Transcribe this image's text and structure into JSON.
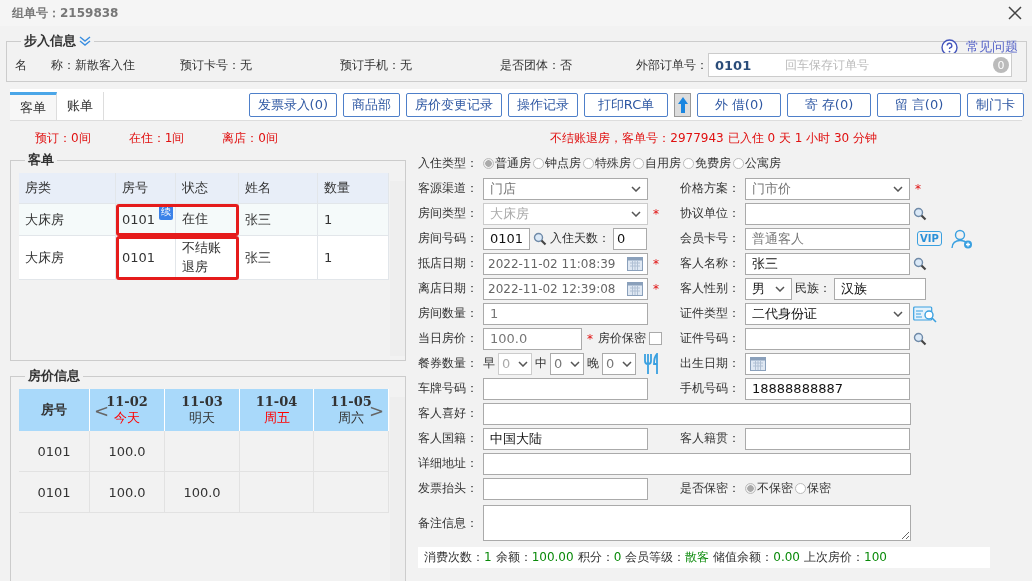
{
  "dialog": {
    "title": "组单号：2159838"
  },
  "checkin_info": {
    "legend": "步入信息",
    "help_link": "常见问题",
    "fields": [
      {
        "label": "名　　称：",
        "value": "新散客入住"
      },
      {
        "label": "预订卡号：",
        "value": "无"
      },
      {
        "label": "预订手机：",
        "value": "无"
      },
      {
        "label": "是否团体：",
        "value": "否"
      }
    ],
    "external_order": {
      "label": "外部订单号：",
      "value": "0101",
      "placeholder": "回车保存订单号",
      "count": "0"
    }
  },
  "tabs": [
    {
      "label": "客单",
      "selected": true
    },
    {
      "label": "账单",
      "selected": false
    }
  ],
  "toolbar": [
    {
      "kind": "text",
      "label": "发票录入(0)"
    },
    {
      "kind": "text",
      "label": "商品部"
    },
    {
      "kind": "text",
      "label": "房价变更记录"
    },
    {
      "kind": "text",
      "label": "操作记录"
    },
    {
      "kind": "text",
      "label": "打印RC单"
    },
    {
      "kind": "arrow"
    },
    {
      "kind": "text",
      "label": "外 借(0)"
    },
    {
      "kind": "text",
      "label": "寄 存(0)"
    },
    {
      "kind": "text",
      "label": "留 言(0)"
    },
    {
      "kind": "text",
      "label": "制门卡"
    }
  ],
  "stats": [
    "预订：0间",
    "在住：1间",
    "离店：0间"
  ],
  "status_message": "不结账退房，客单号：2977943 已入住 0 天 1 小时 30 分钟",
  "guest_table": {
    "legend": "客单",
    "columns": [
      "房类",
      "房号",
      "状态",
      "姓名",
      "数量"
    ],
    "rows": [
      {
        "cells": [
          "大床房",
          "0101",
          "在住",
          "张三",
          "1"
        ],
        "badge": "续",
        "highlighted": true
      },
      {
        "cells": [
          "大床房",
          "0101",
          "不结账退房",
          "张三",
          "1"
        ],
        "highlighted": true
      }
    ]
  },
  "price_table": {
    "legend": "房价信息",
    "room_header": "房号",
    "prev": "<",
    "next": ">",
    "days": [
      {
        "date": "11-02",
        "label": "今天",
        "emphasized": true
      },
      {
        "date": "11-03",
        "label": "明天",
        "emphasized": false
      },
      {
        "date": "11-04",
        "label": "周五",
        "emphasized": true
      },
      {
        "date": "11-05",
        "label": "周六",
        "emphasized": false
      }
    ],
    "rows": [
      {
        "room": "0101",
        "prices": [
          "100.0"
        ]
      },
      {
        "room": "0101",
        "prices": [
          "100.0",
          "100.0"
        ]
      }
    ]
  },
  "form": [
    {
      "wide": {
        "label": "入住类型：",
        "controls": [
          {
            "kind": "radios",
            "options": [
              {
                "label": "普通房",
                "selected": true
              },
              {
                "label": "钟点房",
                "selected": false
              },
              {
                "label": "特殊房",
                "selected": false
              },
              {
                "label": "自用房",
                "selected": false
              },
              {
                "label": "免费房",
                "selected": false
              },
              {
                "label": "公寓房",
                "selected": false
              }
            ]
          }
        ]
      }
    },
    {
      "left": {
        "label": "客源渠道：",
        "controls": [
          {
            "kind": "select",
            "value": "门店"
          }
        ]
      },
      "right": {
        "label": "价格方案：",
        "controls": [
          {
            "kind": "select",
            "value": "门市价"
          },
          {
            "kind": "required",
            "text": "*"
          }
        ]
      }
    },
    {
      "left": {
        "label": "房间类型：",
        "controls": [
          {
            "kind": "select",
            "value": "大床房",
            "disabled": true
          },
          {
            "kind": "required",
            "text": "*"
          }
        ]
      },
      "right": {
        "label": "协议单位：",
        "controls": [
          {
            "kind": "text"
          },
          {
            "kind": "lookup"
          }
        ]
      }
    },
    {
      "left": {
        "label": "房间号码：",
        "controls": [
          {
            "kind": "short-text",
            "value": "0101"
          },
          {
            "kind": "lookup"
          },
          {
            "kind": "caption",
            "text": "入住天数："
          },
          {
            "kind": "tiny-text",
            "value": "0"
          }
        ]
      },
      "right": {
        "label": "会员卡号：",
        "controls": [
          {
            "kind": "text",
            "value": "普通客人",
            "muted": true
          },
          {
            "kind": "vip",
            "text": "VIP"
          },
          {
            "kind": "add-member"
          }
        ]
      }
    },
    {
      "left": {
        "label": "抵店日期：",
        "controls": [
          {
            "kind": "date",
            "value": "2022-11-02 11:08:39"
          },
          {
            "kind": "required",
            "text": "*"
          }
        ]
      },
      "right": {
        "label": "客人名称：",
        "controls": [
          {
            "kind": "text",
            "value": "张三"
          },
          {
            "kind": "lookup"
          }
        ]
      }
    },
    {
      "left": {
        "label": "离店日期：",
        "controls": [
          {
            "kind": "date",
            "value": "2022-11-02 12:39:08"
          },
          {
            "kind": "required",
            "text": "*"
          }
        ]
      },
      "right": {
        "label": "客人性别：",
        "controls": [
          {
            "kind": "short-select",
            "value": "男",
            "dark": true
          },
          {
            "kind": "caption",
            "text": "民族："
          },
          {
            "kind": "narrow-text",
            "value": "汉族"
          }
        ]
      }
    },
    {
      "left": {
        "label": "房间数量：",
        "controls": [
          {
            "kind": "text",
            "value": "1",
            "muted": true
          }
        ]
      },
      "right": {
        "label": "证件类型：",
        "controls": [
          {
            "kind": "select",
            "value": "二代身份证",
            "dark": true
          },
          {
            "kind": "scan"
          }
        ]
      }
    },
    {
      "left": {
        "label": "当日房价：",
        "controls": [
          {
            "kind": "medium-text",
            "value": "100.0",
            "muted": true
          },
          {
            "kind": "required",
            "text": "*"
          },
          {
            "kind": "caption",
            "text": "房价保密"
          },
          {
            "kind": "checkbox",
            "checked": false
          }
        ]
      },
      "right": {
        "label": "证件号码：",
        "controls": [
          {
            "kind": "text"
          },
          {
            "kind": "lookup"
          }
        ]
      }
    },
    {
      "left": {
        "label": "餐券数量：",
        "controls": [
          {
            "kind": "caption",
            "text": "早"
          },
          {
            "kind": "tiny-select",
            "value": "0",
            "disabled": true
          },
          {
            "kind": "caption",
            "text": "中"
          },
          {
            "kind": "tiny-select",
            "value": "0"
          },
          {
            "kind": "caption",
            "text": "晚"
          },
          {
            "kind": "tiny-select",
            "value": "0"
          },
          {
            "kind": "meal"
          }
        ]
      },
      "right": {
        "label": "出生日期：",
        "controls": [
          {
            "kind": "date"
          }
        ]
      }
    },
    {
      "left": {
        "label": "车牌号码：",
        "controls": [
          {
            "kind": "text"
          }
        ]
      },
      "right": {
        "label": "手机号码：",
        "controls": [
          {
            "kind": "text",
            "value": "18888888887"
          }
        ]
      }
    },
    {
      "wide": {
        "label": "客人喜好：",
        "controls": [
          {
            "kind": "wide-text"
          }
        ]
      }
    },
    {
      "left": {
        "label": "客人国籍：",
        "controls": [
          {
            "kind": "text",
            "value": "中国大陆"
          }
        ]
      },
      "right": {
        "label": "客人籍贯：",
        "controls": [
          {
            "kind": "text"
          }
        ]
      }
    },
    {
      "wide": {
        "label": "详细地址：",
        "controls": [
          {
            "kind": "wide-text"
          }
        ]
      }
    },
    {
      "left": {
        "label": "发票抬头：",
        "controls": [
          {
            "kind": "text"
          }
        ]
      },
      "right": {
        "label": "是否保密：",
        "controls": [
          {
            "kind": "radios",
            "options": [
              {
                "label": "不保密",
                "selected": true
              },
              {
                "label": "保密",
                "selected": false
              }
            ]
          }
        ]
      }
    },
    {
      "wide": {
        "label": "备注信息：",
        "controls": [
          {
            "kind": "textarea"
          }
        ]
      }
    }
  ],
  "summary": [
    {
      "label": "消费次数：",
      "value": "1"
    },
    {
      "label": "余额：",
      "value": "100.00"
    },
    {
      "label": "积分：",
      "value": "0"
    },
    {
      "label": "会员等级：",
      "value": "散客"
    },
    {
      "label": "储值余额：",
      "value": "0.00"
    },
    {
      "label": "上次房价：",
      "value": "100"
    }
  ]
}
